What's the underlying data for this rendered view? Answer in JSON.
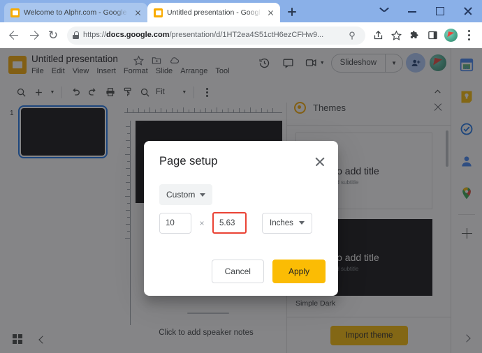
{
  "browser": {
    "tabs": [
      {
        "title": "Welcome to Alphr.com - Google",
        "favicon": "slides-favicon",
        "active": false
      },
      {
        "title": "Untitled presentation - Google S",
        "favicon": "slides-favicon",
        "active": true
      }
    ],
    "new_tab_label": "+",
    "window_controls": [
      "chevron-down",
      "minimize",
      "maximize",
      "close"
    ],
    "nav": {
      "back": "back-arrow",
      "forward": "forward-arrow",
      "reload": "⟳"
    },
    "omnibox": {
      "lock": "lock-icon",
      "url_prefix": "https://",
      "url_domain": "docs.google.com",
      "url_path": "/presentation/d/1HT2ea4S51ctH6ezCFHw9...",
      "url_full": "https://docs.google.com/presentation/d/1HT2ea4S51ctH6ezCFHw9..."
    },
    "toolbar_icons": [
      "search-icon",
      "share-icon",
      "bookmark-star-icon",
      "extensions-icon",
      "side-panel-icon",
      "profile-avatar",
      "chrome-menu-icon"
    ]
  },
  "slides": {
    "doc_title": "Untitled presentation",
    "title_icons": [
      "star-icon",
      "move-to-folder-icon",
      "cloud-saved-icon"
    ],
    "menu": [
      "File",
      "Edit",
      "View",
      "Insert",
      "Format",
      "Slide",
      "Arrange",
      "Tool"
    ],
    "header_right": {
      "history_icon": "version-history-icon",
      "comment_icon": "comment-icon",
      "meet_icon": "meet-camera-icon",
      "slideshow_label": "Slideshow",
      "share_icon": "add-person-icon",
      "account_avatar": "account-avatar"
    },
    "toolbar": {
      "icons": [
        "search-icon",
        "new-slide-icon",
        "new-slide-dropdown",
        "undo-icon",
        "redo-icon",
        "print-icon",
        "paint-format-icon",
        "zoom-icon"
      ],
      "zoom_label": "Fit",
      "more_icon": "more-options-icon",
      "collapse_icon": "collapse-toolbar-icon"
    },
    "filmstrip": {
      "slide_number": "1"
    },
    "notes_placeholder": "Click to add speaker notes",
    "bottom_bar": {
      "grid_icon": "grid-view-icon",
      "collapse_icon": "collapse-filmstrip-icon"
    },
    "themes_panel": {
      "icon": "themes-palette-icon",
      "title": "Themes",
      "close_icon": "close-panel-icon",
      "themes": [
        {
          "name": "",
          "title": "Click to add title",
          "subtitle": "Click to add subtitle",
          "dark": false
        },
        {
          "name": "Simple Dark",
          "title": "Click to add title",
          "subtitle": "Click to add subtitle",
          "dark": true
        }
      ],
      "import_label": "Import theme"
    },
    "side_rail": {
      "icons": [
        "google-calendar-icon",
        "google-keep-icon",
        "google-tasks-icon",
        "google-contacts-icon",
        "google-maps-icon"
      ],
      "add_icon": "get-addons-icon",
      "expand_icon": "expand-rail-icon"
    }
  },
  "dialog": {
    "title": "Page setup",
    "close_icon": "close-dialog-icon",
    "preset_value": "Custom",
    "width_value": "10",
    "separator": "×",
    "height_value": "5.63",
    "unit_value": "Inches",
    "cancel_label": "Cancel",
    "apply_label": "Apply",
    "highlight_color": "#ea4335",
    "apply_color": "#fbbc04"
  }
}
